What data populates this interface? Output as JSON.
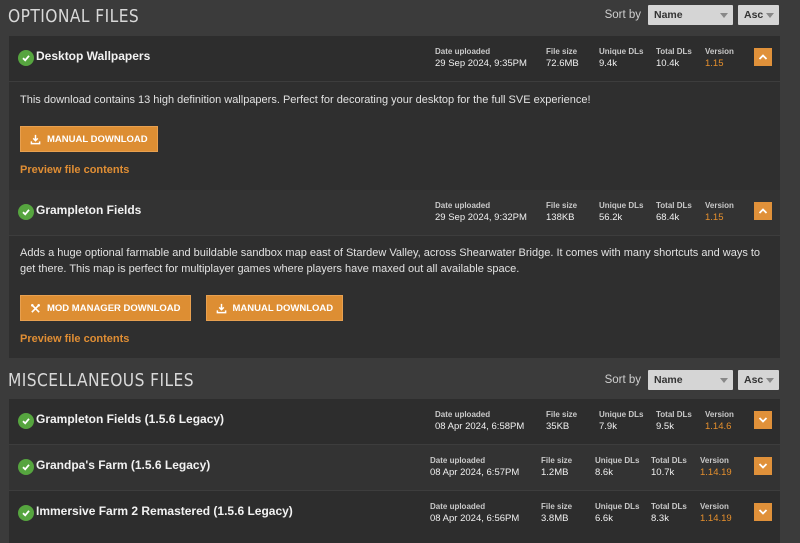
{
  "optional": {
    "title": "OPTIONAL FILES",
    "sort_label": "Sort by",
    "sort_field": "Name",
    "sort_dir": "Asc",
    "files": [
      {
        "name": "Desktop Wallpapers",
        "date_label": "Date uploaded",
        "date": "29 Sep 2024, 9:35PM",
        "size_label": "File size",
        "size": "72.6MB",
        "unique_label": "Unique DLs",
        "unique": "9.4k",
        "total_label": "Total DLs",
        "total": "10.4k",
        "version_label": "Version",
        "version": "1.15",
        "description": "This download contains 13 high definition wallpapers. Perfect for decorating your desktop for the full SVE experience!",
        "manual_label": "MANUAL DOWNLOAD",
        "preview_label": "Preview file contents"
      },
      {
        "name": "Grampleton Fields",
        "date_label": "Date uploaded",
        "date": "29 Sep 2024, 9:32PM",
        "size_label": "File size",
        "size": "138KB",
        "unique_label": "Unique DLs",
        "unique": "56.2k",
        "total_label": "Total DLs",
        "total": "68.4k",
        "version_label": "Version",
        "version": "1.15",
        "description": "Adds a huge optional farmable and buildable sandbox map east of Stardew Valley, across Shearwater Bridge. It comes with many shortcuts and ways to get there. This map is perfect for multiplayer games where players have maxed out all available space.",
        "mod_manager_label": "MOD MANAGER DOWNLOAD",
        "manual_label": "MANUAL DOWNLOAD",
        "preview_label": "Preview file contents"
      }
    ]
  },
  "misc": {
    "title": "MISCELLANEOUS FILES",
    "sort_label": "Sort by",
    "sort_field": "Name",
    "sort_dir": "Asc",
    "files": [
      {
        "name": "Grampleton Fields (1.5.6 Legacy)",
        "date_label": "Date uploaded",
        "date": "08 Apr 2024, 6:58PM",
        "size_label": "File size",
        "size": "35KB",
        "unique_label": "Unique DLs",
        "unique": "7.9k",
        "total_label": "Total DLs",
        "total": "9.5k",
        "version_label": "Version",
        "version": "1.14.6"
      },
      {
        "name": "Grandpa's Farm (1.5.6 Legacy)",
        "date_label": "Date uploaded",
        "date": "08 Apr 2024, 6:57PM",
        "size_label": "File size",
        "size": "1.2MB",
        "unique_label": "Unique DLs",
        "unique": "8.6k",
        "total_label": "Total DLs",
        "total": "10.7k",
        "version_label": "Version",
        "version": "1.14.19"
      },
      {
        "name": "Immersive Farm 2 Remastered (1.5.6 Legacy)",
        "date_label": "Date uploaded",
        "date": "08 Apr 2024, 6:56PM",
        "size_label": "File size",
        "size": "3.8MB",
        "unique_label": "Unique DLs",
        "unique": "6.6k",
        "total_label": "Total DLs",
        "total": "8.3k",
        "version_label": "Version",
        "version": "1.14.19"
      }
    ]
  },
  "colors": {
    "accent": "#dd8e33",
    "check": "#56a53f",
    "background": "#3b3b3b",
    "panel": "#2d2d2d"
  },
  "icons": {
    "check": "check-circle-icon",
    "collapse": "chevron-up-icon",
    "expand": "chevron-down-icon",
    "download": "download-icon",
    "mod_manager": "mod-manager-icon"
  }
}
